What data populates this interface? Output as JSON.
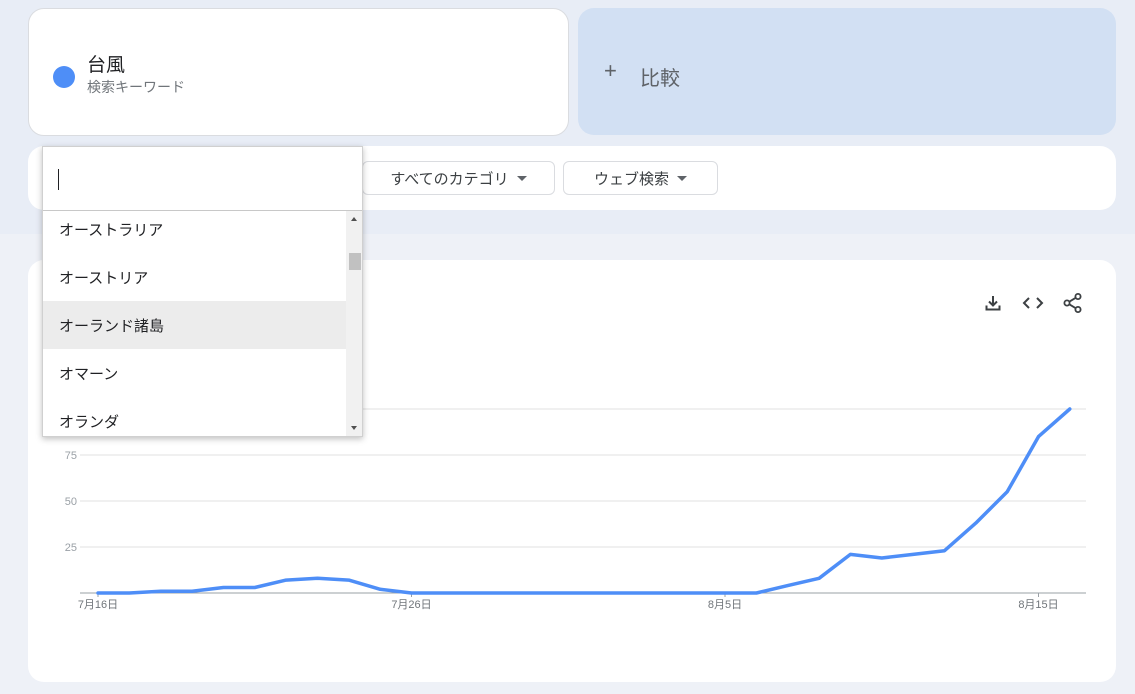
{
  "term": {
    "name": "台風",
    "subtitle": "検索キーワード",
    "color": "#4e8ef7"
  },
  "compare": {
    "plus": "+",
    "label": "比較"
  },
  "filters": {
    "category": "すべてのカテゴリ",
    "search_type": "ウェブ検索"
  },
  "dropdown": {
    "input_value": "",
    "items": [
      "オーストラリア",
      "オーストリア",
      "オーランド諸島",
      "オマーン",
      "オランダ"
    ],
    "highlighted_index": 2
  },
  "toolbar_icons": [
    "download-icon",
    "embed-icon",
    "share-icon"
  ],
  "chart_data": {
    "type": "line",
    "series": [
      {
        "color": "#4e8ef7",
        "x": [
          "2023-07-16",
          "2023-07-17",
          "2023-07-18",
          "2023-07-19",
          "2023-07-20",
          "2023-07-21",
          "2023-07-22",
          "2023-07-23",
          "2023-07-24",
          "2023-07-25",
          "2023-07-26",
          "2023-07-27",
          "2023-07-28",
          "2023-07-29",
          "2023-07-30",
          "2023-07-31",
          "2023-08-01",
          "2023-08-02",
          "2023-08-03",
          "2023-08-04",
          "2023-08-05",
          "2023-08-06",
          "2023-08-07",
          "2023-08-08",
          "2023-08-09",
          "2023-08-10",
          "2023-08-11",
          "2023-08-12",
          "2023-08-13",
          "2023-08-14",
          "2023-08-15",
          "2023-08-16"
        ],
        "values": [
          0,
          0,
          1,
          1,
          3,
          3,
          7,
          8,
          7,
          2,
          0,
          0,
          0,
          0,
          0,
          0,
          0,
          0,
          0,
          0,
          0,
          0,
          4,
          8,
          21,
          19,
          21,
          23,
          38,
          55,
          85,
          100
        ]
      }
    ],
    "ylim": [
      0,
      100
    ],
    "yticks": [
      0,
      25,
      50,
      75,
      100
    ],
    "ytick_labels": [
      "25",
      "50",
      "75"
    ],
    "xtick_labels": [
      {
        "label": "7月16日",
        "date": "2023-07-16"
      },
      {
        "label": "7月26日",
        "date": "2023-07-26"
      },
      {
        "label": "8月5日",
        "date": "2023-08-05"
      },
      {
        "label": "8月15日",
        "date": "2023-08-15"
      }
    ],
    "grid": true
  }
}
